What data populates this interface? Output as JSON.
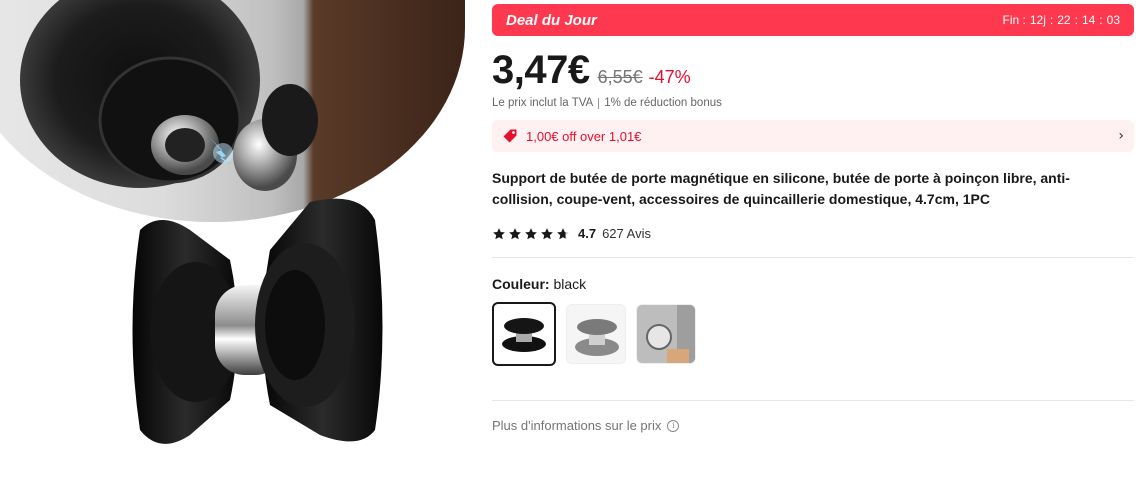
{
  "deal": {
    "title": "Deal du Jour",
    "timer_prefix": "Fin :",
    "days": "12j",
    "hours": "22",
    "minutes": "14",
    "seconds": "03",
    "sep": ":",
    "color": "#fd384f"
  },
  "price": {
    "current": "3,47€",
    "original": "6,55€",
    "discount": "-47%"
  },
  "tax": {
    "included": "Le prix inclut la TVA",
    "bonus": "1% de réduction bonus"
  },
  "coupon": {
    "text": "1,00€ off over 1,01€",
    "icon": "tag-icon"
  },
  "product": {
    "title": "Support de butée de porte magnétique en silicone, butée de porte à poinçon libre, anti-collision, coupe-vent, accessoires de quincaillerie domestique, 4.7cm, 1PC"
  },
  "rating": {
    "value": "4.7",
    "reviews": "627 Avis",
    "stars": 4.7
  },
  "variant": {
    "label": "Couleur:",
    "selected": "black",
    "options": [
      "black",
      "grey",
      "installed"
    ]
  },
  "more_info": {
    "text": "Plus d'informations sur le prix",
    "icon": "info-icon"
  }
}
